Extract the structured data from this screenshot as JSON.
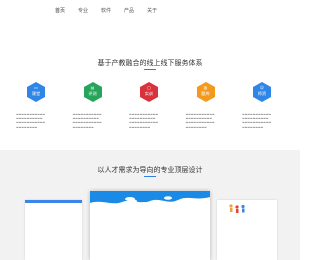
{
  "nav": {
    "items": [
      {
        "label": "首页",
        "active": true
      },
      {
        "label": "专业",
        "active": false
      },
      {
        "label": "软件",
        "active": false
      },
      {
        "label": "产品",
        "active": false
      },
      {
        "label": "关于",
        "active": false
      }
    ]
  },
  "section1": {
    "title": "基于产教融合的线上线下服务体系",
    "cards": [
      {
        "label": "课堂",
        "icon": "chalkboard-icon",
        "color": "#2f86e6"
      },
      {
        "label": "评测",
        "icon": "chart-icon",
        "color": "#27a35a"
      },
      {
        "label": "实训",
        "icon": "monitor-icon",
        "color": "#d9323a"
      },
      {
        "label": "题库",
        "icon": "database-icon",
        "color": "#f39a1d"
      },
      {
        "label": "师资",
        "icon": "teacher-icon",
        "color": "#2f86e6"
      }
    ]
  },
  "section2": {
    "title": "以人才需求为导向的专业顶层设计"
  },
  "colors": {
    "accent": "#2f7fe6",
    "band": "#f2f2f2"
  }
}
